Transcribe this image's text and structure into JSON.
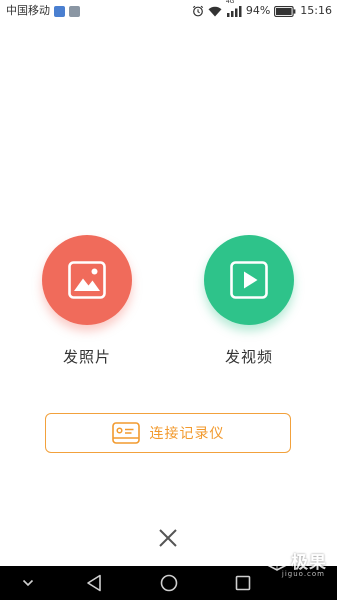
{
  "status_bar": {
    "carrier": "中国移动",
    "network": "4G",
    "battery": "94%",
    "time": "15:16"
  },
  "actions": {
    "photo": {
      "label": "发照片",
      "color": "#f06b5b",
      "icon": "image-icon"
    },
    "video": {
      "label": "发视频",
      "color": "#2ec38a",
      "icon": "play-icon"
    }
  },
  "connect": {
    "label": "连接记录仪",
    "color": "#f29a2e",
    "icon": "recorder-icon"
  },
  "close": {
    "icon": "close-icon"
  },
  "nav_bar": {
    "items": [
      "chevron-down-icon",
      "back-icon",
      "home-icon",
      "recent-apps-icon"
    ]
  },
  "watermark": {
    "text": "极果",
    "sub": "jiguo.com"
  }
}
